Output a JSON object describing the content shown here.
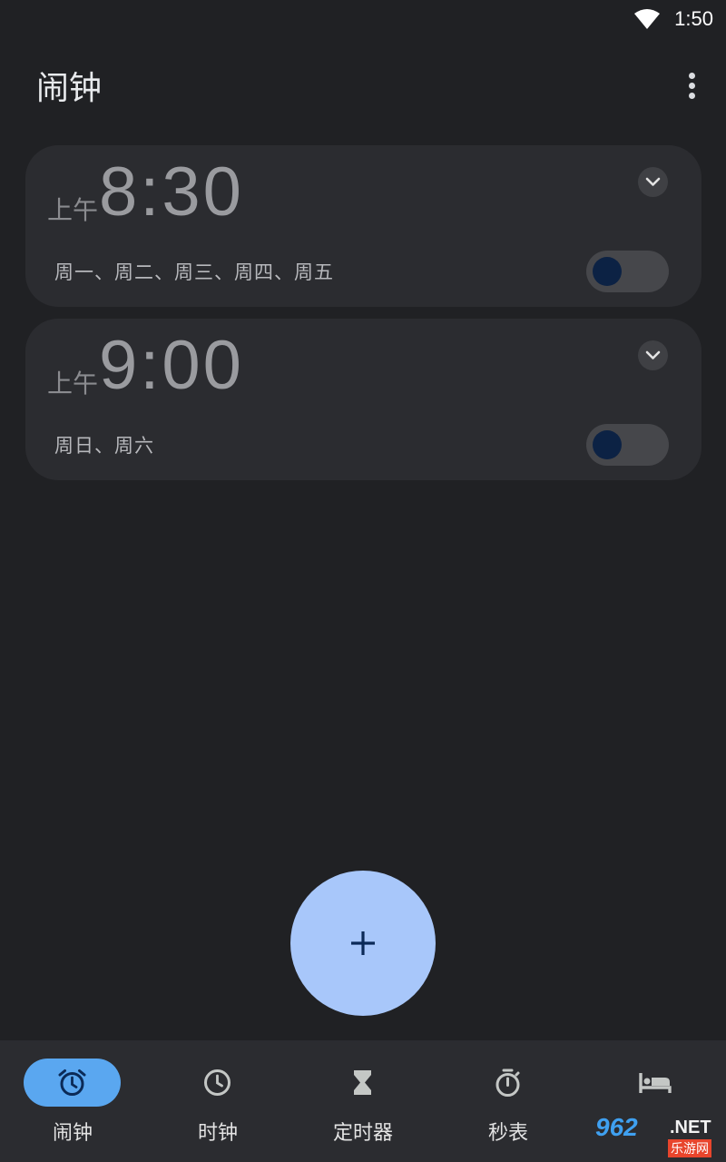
{
  "status_bar": {
    "time": "1:50",
    "wifi_icon": "wifi-icon"
  },
  "app_bar": {
    "title": "闹钟",
    "menu_icon": "more-vert-icon"
  },
  "alarms": [
    {
      "ampm": "上午",
      "time": "8:30",
      "days": "周一、周二、周三、周四、周五",
      "enabled": false
    },
    {
      "ampm": "上午",
      "time": "9:00",
      "days": "周日、周六",
      "enabled": false
    }
  ],
  "fab": {
    "icon": "plus-icon"
  },
  "bottom_nav": [
    {
      "label": "闹钟",
      "icon": "alarm-icon",
      "active": true
    },
    {
      "label": "时钟",
      "icon": "clock-icon",
      "active": false
    },
    {
      "label": "定时器",
      "icon": "hourglass-icon",
      "active": false
    },
    {
      "label": "秒表",
      "icon": "stopwatch-icon",
      "active": false
    },
    {
      "label": "",
      "icon": "bed-icon",
      "active": false
    }
  ],
  "watermark": {
    "main": "962",
    "suffix": ".NET",
    "sub": "乐游网"
  },
  "colors": {
    "background": "#202124",
    "card": "#2b2c30",
    "fab": "#a8c7fa",
    "active_nav_pill": "#5aa7f0",
    "toggle_thumb": "#0c2244"
  }
}
